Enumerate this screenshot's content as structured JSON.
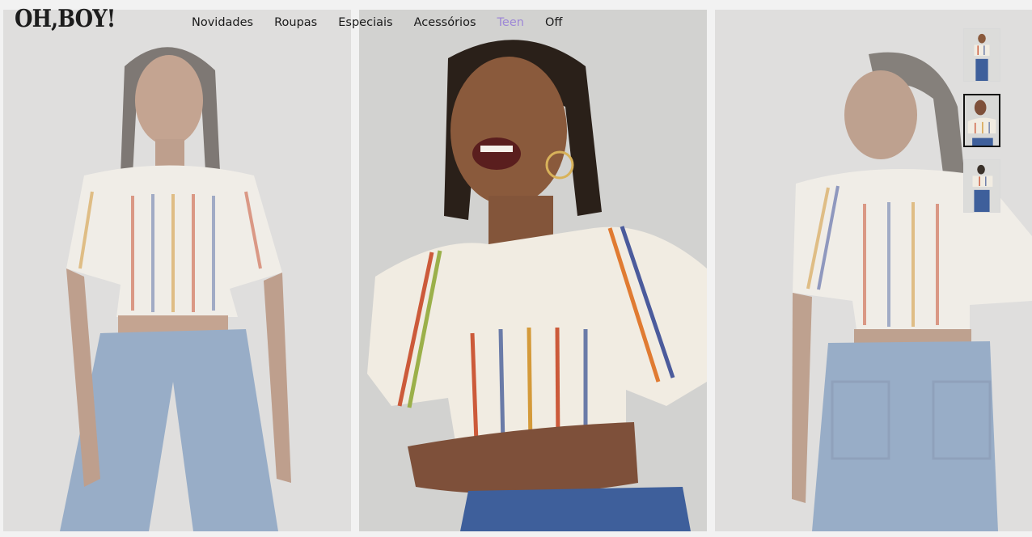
{
  "brand": {
    "logo_text": "OH,BOY!"
  },
  "nav": {
    "items": [
      {
        "label": "Novidades",
        "active": false
      },
      {
        "label": "Roupas",
        "active": false
      },
      {
        "label": "Especiais",
        "active": false
      },
      {
        "label": "Acessórios",
        "active": false
      },
      {
        "label": "Teen",
        "active": true
      },
      {
        "label": "Off",
        "active": false
      }
    ]
  },
  "gallery": {
    "photos": [
      {
        "view": "front",
        "icon": "model-photo-icon"
      },
      {
        "view": "smiling",
        "icon": "model-photo-icon"
      },
      {
        "view": "back",
        "icon": "model-photo-icon"
      }
    ],
    "thumbnails": [
      {
        "view": "front",
        "selected": false
      },
      {
        "view": "smiling",
        "selected": true
      },
      {
        "view": "back",
        "selected": false
      }
    ]
  },
  "colors": {
    "active_nav": "#9d87d6",
    "jeans": "#5b7fab",
    "skin": "#8a5a3c",
    "blouse": "#f1ece2"
  }
}
